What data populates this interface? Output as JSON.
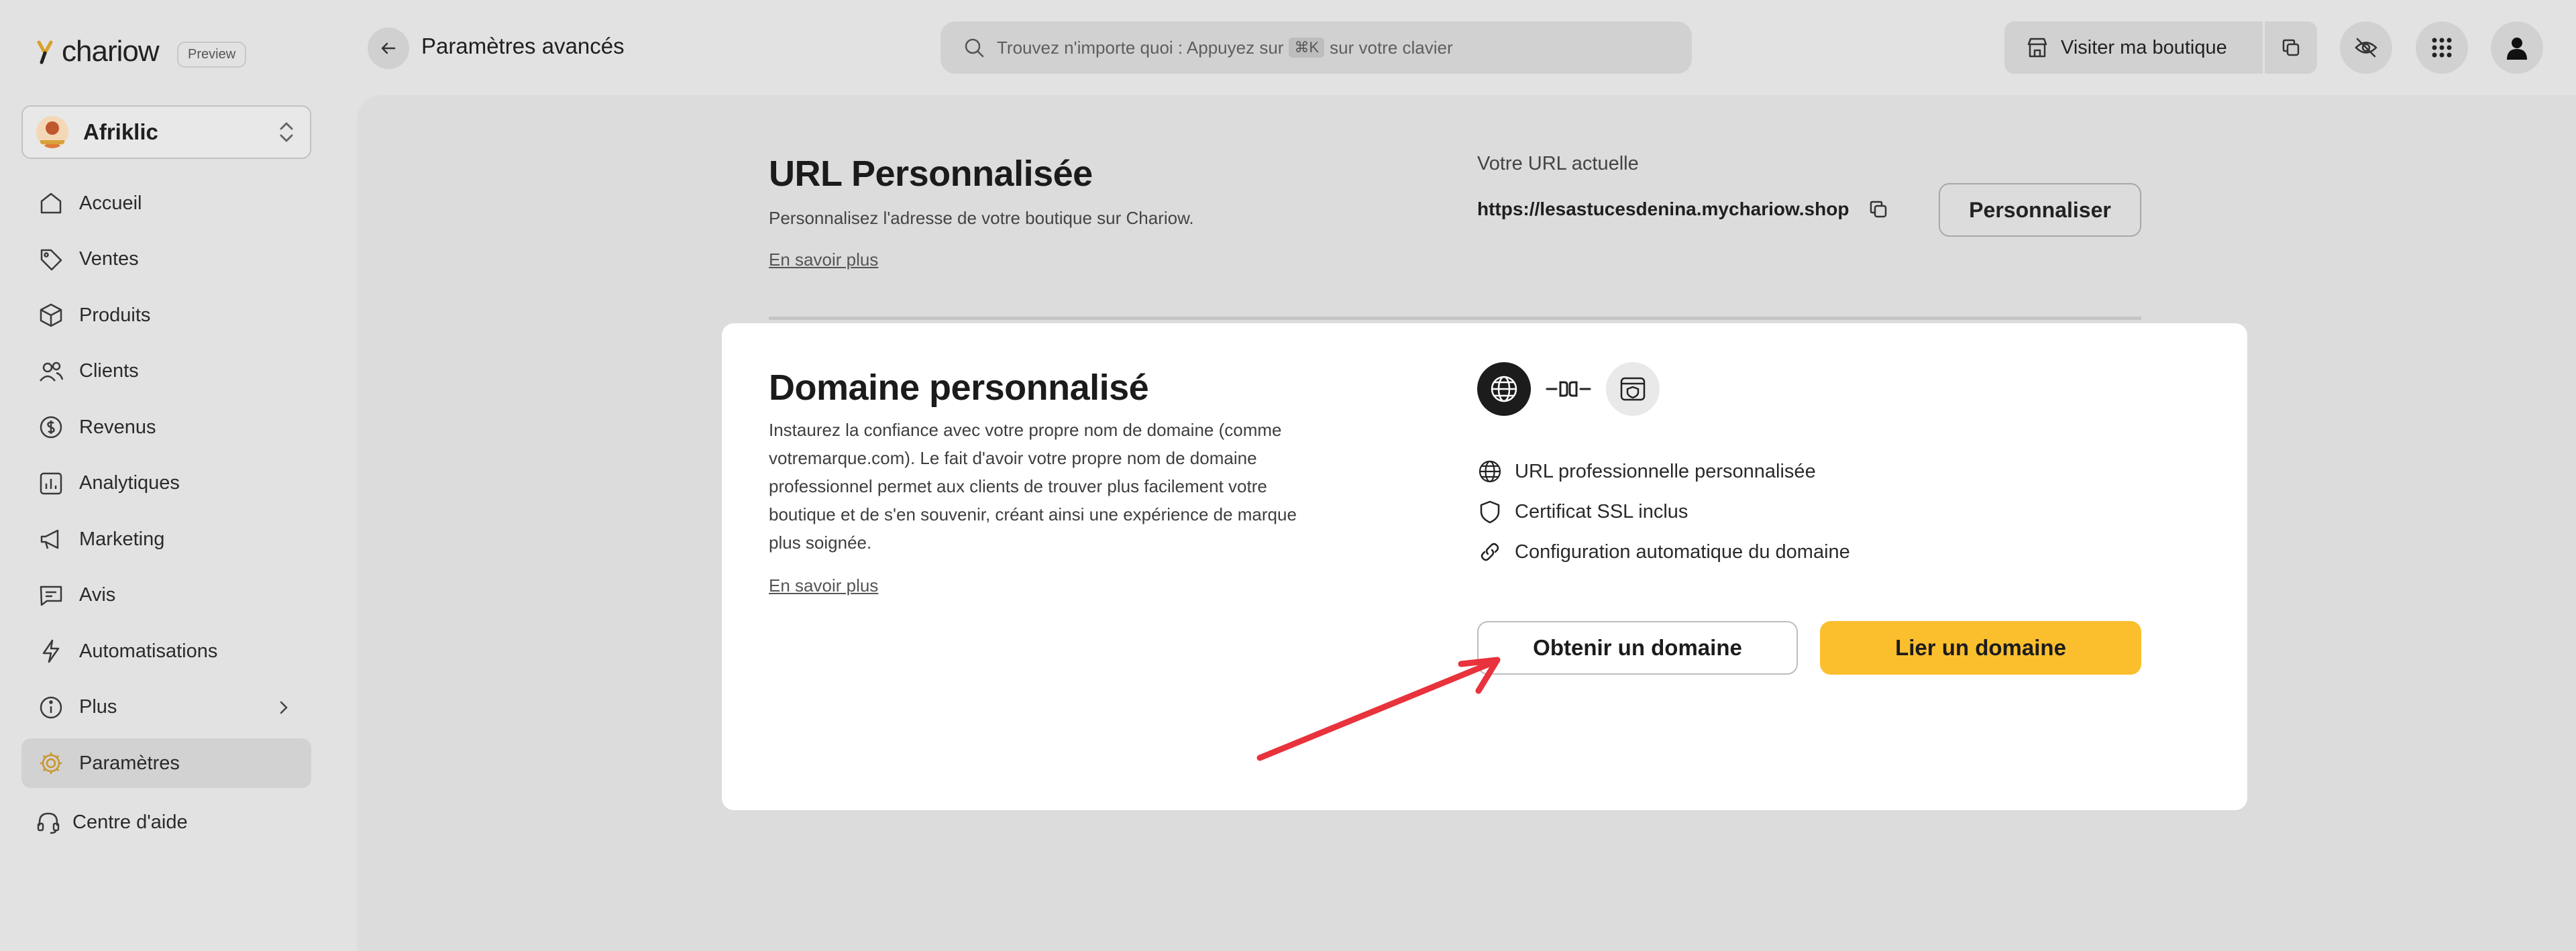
{
  "app": {
    "logo_text": "chariow",
    "preview_badge": "Preview"
  },
  "store": {
    "name": "Afriklic"
  },
  "sidebar": {
    "items": [
      {
        "label": "Accueil",
        "icon": "home-icon"
      },
      {
        "label": "Ventes",
        "icon": "tag-icon"
      },
      {
        "label": "Produits",
        "icon": "box-icon"
      },
      {
        "label": "Clients",
        "icon": "users-icon"
      },
      {
        "label": "Revenus",
        "icon": "dollar-circle-icon"
      },
      {
        "label": "Analytiques",
        "icon": "chart-icon"
      },
      {
        "label": "Marketing",
        "icon": "megaphone-icon"
      },
      {
        "label": "Avis",
        "icon": "message-icon"
      },
      {
        "label": "Automatisations",
        "icon": "bolt-icon"
      },
      {
        "label": "Plus",
        "icon": "info-circle-icon"
      },
      {
        "label": "Paramètres",
        "icon": "gear-icon",
        "active": true
      }
    ],
    "help_label": "Centre d'aide"
  },
  "header": {
    "title": "Paramètres avancés",
    "search": {
      "prefix": "Trouvez n'importe quoi : Appuyez sur",
      "kbd": "⌘K",
      "suffix": "sur votre clavier"
    },
    "visit_label": "Visiter ma boutique"
  },
  "url_section": {
    "title": "URL Personnalisée",
    "description": "Personnalisez l'adresse de votre boutique sur Chariow.",
    "learn_more": "En savoir plus",
    "current_label": "Votre URL actuelle",
    "current_url": "https://lesastucesdenina.mychariow.shop",
    "customize_label": "Personnaliser"
  },
  "domain_modal": {
    "title": "Domaine personnalisé",
    "description": "Instaurez la confiance avec votre propre nom de domaine (comme votremarque.com). Le fait d'avoir votre propre nom de domaine professionnel permet aux clients de trouver plus facilement votre boutique et de s'en souvenir, créant ainsi une expérience de marque plus soignée.",
    "learn_more": "En savoir plus",
    "features": [
      {
        "label": "URL professionnelle personnalisée",
        "icon": "globe-icon"
      },
      {
        "label": "Certificat SSL inclus",
        "icon": "shield-icon"
      },
      {
        "label": "Configuration automatique du domaine",
        "icon": "link-icon"
      }
    ],
    "get_domain_label": "Obtenir un domaine",
    "link_domain_label": "Lier un domaine"
  },
  "colors": {
    "accent_yellow": "#fbbf2e",
    "arrow_red": "#e8323c"
  }
}
